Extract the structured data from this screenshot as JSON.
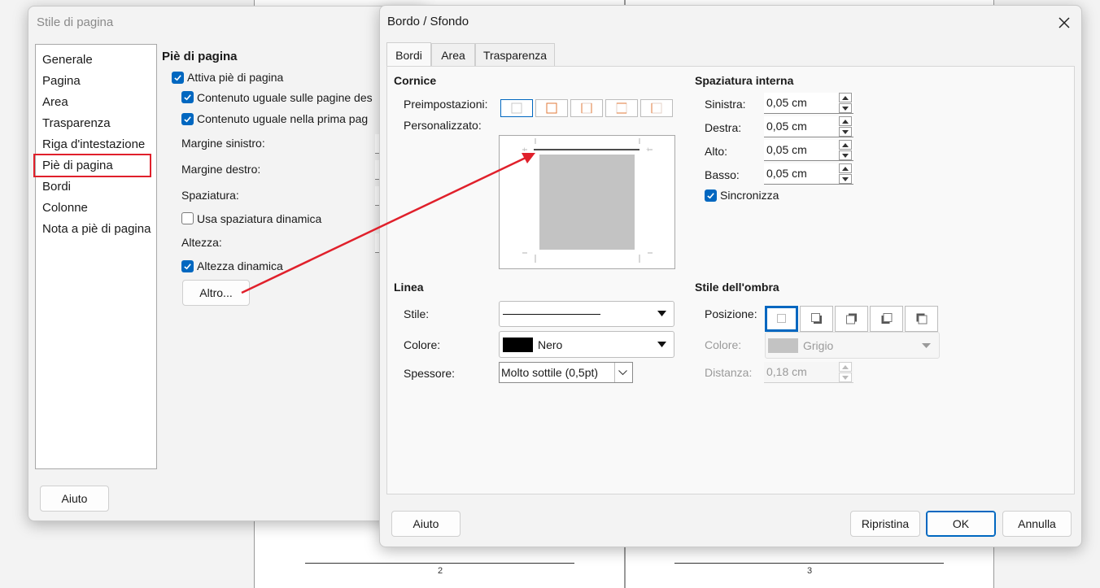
{
  "doc": {
    "page_numbers": [
      "2",
      "3"
    ]
  },
  "page_style_dialog": {
    "title": "Stile di pagina",
    "nav_items": [
      "Generale",
      "Pagina",
      "Area",
      "Trasparenza",
      "Riga d'intestazione",
      "Piè di pagina",
      "Bordi",
      "Colonne",
      "Nota a piè di pagina"
    ],
    "selected_nav": "Piè di pagina",
    "section_title": "Piè di pagina",
    "checks": {
      "activate": "Attiva piè di pagina",
      "same_content_sides": "Contenuto uguale sulle pagine des",
      "same_content_first": "Contenuto uguale nella prima pag"
    },
    "left_margin_label": "Margine sinistro:",
    "right_margin_label": "Margine destro:",
    "spacing_label": "Spaziatura:",
    "dynamic_spacing": "Usa spaziatura dinamica",
    "height_label": "Altezza:",
    "dynamic_height": "Altezza dinamica",
    "more_button": "Altro...",
    "help_button": "Aiuto",
    "highlight_color": "#e0202b"
  },
  "border_dialog": {
    "title": "Bordo / Sfondo",
    "tabs": [
      "Bordi",
      "Area",
      "Trasparenza"
    ],
    "frame": {
      "title": "Cornice",
      "presets_label": "Preimpostazioni:",
      "custom_label": "Personalizzato:"
    },
    "padding": {
      "title": "Spaziatura interna",
      "left_label": "Sinistra:",
      "left_value": "0,05 cm",
      "right_label": "Destra:",
      "right_value": "0,05 cm",
      "top_label": "Alto:",
      "top_value": "0,05 cm",
      "bottom_label": "Basso:",
      "bottom_value": "0,05 cm",
      "sync_label": "Sincronizza"
    },
    "line": {
      "title": "Linea",
      "style_label": "Stile:",
      "color_label": "Colore:",
      "color_value": "Nero",
      "width_label": "Spessore:",
      "width_value": "Molto sottile (0,5pt)"
    },
    "shadow": {
      "title": "Stile dell'ombra",
      "position_label": "Posizione:",
      "color_label": "Colore:",
      "color_value": "Grigio",
      "distance_label": "Distanza:",
      "distance_value": "0,18 cm"
    },
    "buttons": {
      "help": "Aiuto",
      "reset": "Ripristina",
      "ok": "OK",
      "cancel": "Annulla"
    },
    "accent_color": "#0067c0",
    "preset_accent": "#e07a3a"
  },
  "annotation_color": "#e0202b"
}
